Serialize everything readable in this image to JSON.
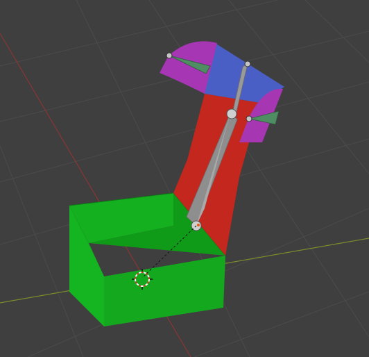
{
  "viewport": {
    "background_color": "#3f3f3f",
    "grid_line_color": "#4a4a4a",
    "x_axis_color": "#7d8a2e",
    "y_axis_color": "#8a3a3a"
  },
  "scene": {
    "objects": [
      {
        "kind": "box-mesh",
        "color": "#18c425",
        "label_icon": "cube-icon"
      },
      {
        "kind": "bone-mesh-red",
        "color": "#c3261c"
      },
      {
        "kind": "bone-mesh-blue",
        "color": "#4a5fc6"
      },
      {
        "kind": "bone-mesh-magenta",
        "color": "#a535b5"
      }
    ],
    "armature": {
      "bone_color": "#8c8c8c",
      "joint_color": "#bfbfbf",
      "selected_joint_color": "#e85a1c"
    },
    "cursor": {
      "icon": "3d-cursor-icon"
    }
  }
}
